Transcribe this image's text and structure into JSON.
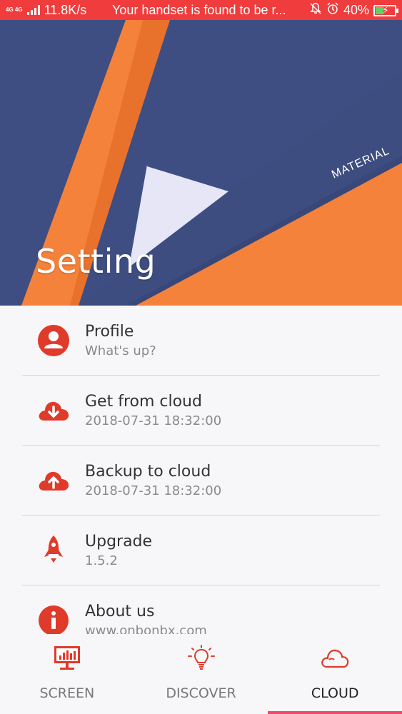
{
  "status_bar": {
    "network": "4G 4G",
    "speed": "11.8K/s",
    "message": "Your handset is found to be r...",
    "battery": "40%",
    "battery_level": 0.4
  },
  "header": {
    "title": "Setting",
    "banner_text": "MATERIAL"
  },
  "settings": [
    {
      "id": "profile",
      "icon": "user-icon",
      "title": "Profile",
      "subtitle": "What's up?"
    },
    {
      "id": "get-from-cloud",
      "icon": "cloud-download-icon",
      "title": "Get from cloud",
      "subtitle": "2018-07-31 18:32:00"
    },
    {
      "id": "backup-to-cloud",
      "icon": "cloud-upload-icon",
      "title": "Backup to cloud",
      "subtitle": "2018-07-31 18:32:00"
    },
    {
      "id": "upgrade",
      "icon": "rocket-icon",
      "title": "Upgrade",
      "subtitle": "1.5.2"
    },
    {
      "id": "about-us",
      "icon": "info-icon",
      "title": "About us",
      "subtitle": "www.onbonbx.com"
    }
  ],
  "bottom_nav": {
    "tabs": [
      {
        "label": "SCREEN",
        "icon": "monitor-chart-icon"
      },
      {
        "label": "DISCOVER",
        "icon": "lightbulb-icon"
      },
      {
        "label": "CLOUD",
        "icon": "cloud-icon"
      }
    ],
    "active": "CLOUD"
  },
  "colors": {
    "status_bar": "#f03c3c",
    "accent_red": "#e03a2a",
    "header_navy": "#3f4e82",
    "header_orange": "#f5823a",
    "indicator": "#ef4a6e"
  }
}
